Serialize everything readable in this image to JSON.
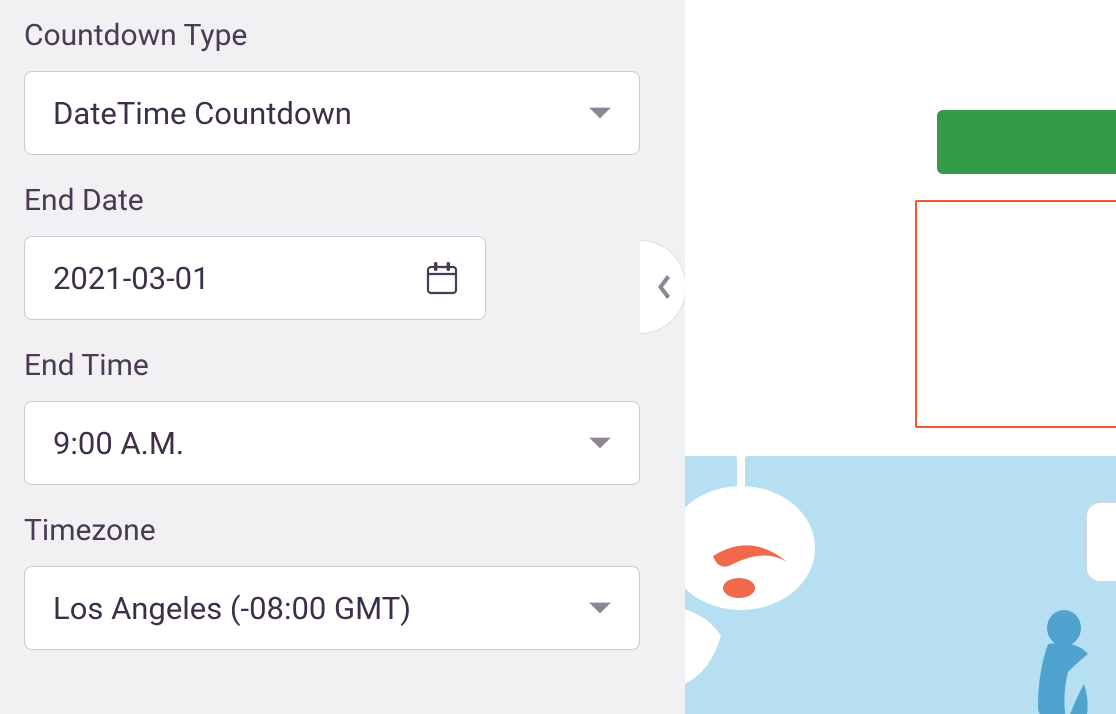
{
  "sidebar": {
    "countdown_type": {
      "label": "Countdown Type",
      "value": "DateTime Countdown"
    },
    "end_date": {
      "label": "End Date",
      "value": "2021-03-01"
    },
    "end_time": {
      "label": "End Time",
      "value": "9:00 A.M."
    },
    "timezone": {
      "label": "Timezone",
      "value": "Los Angeles (-08:00 GMT)"
    }
  },
  "colors": {
    "green": "#339a47",
    "outline_orange": "#f15a29",
    "sky": "#b6dff2"
  }
}
